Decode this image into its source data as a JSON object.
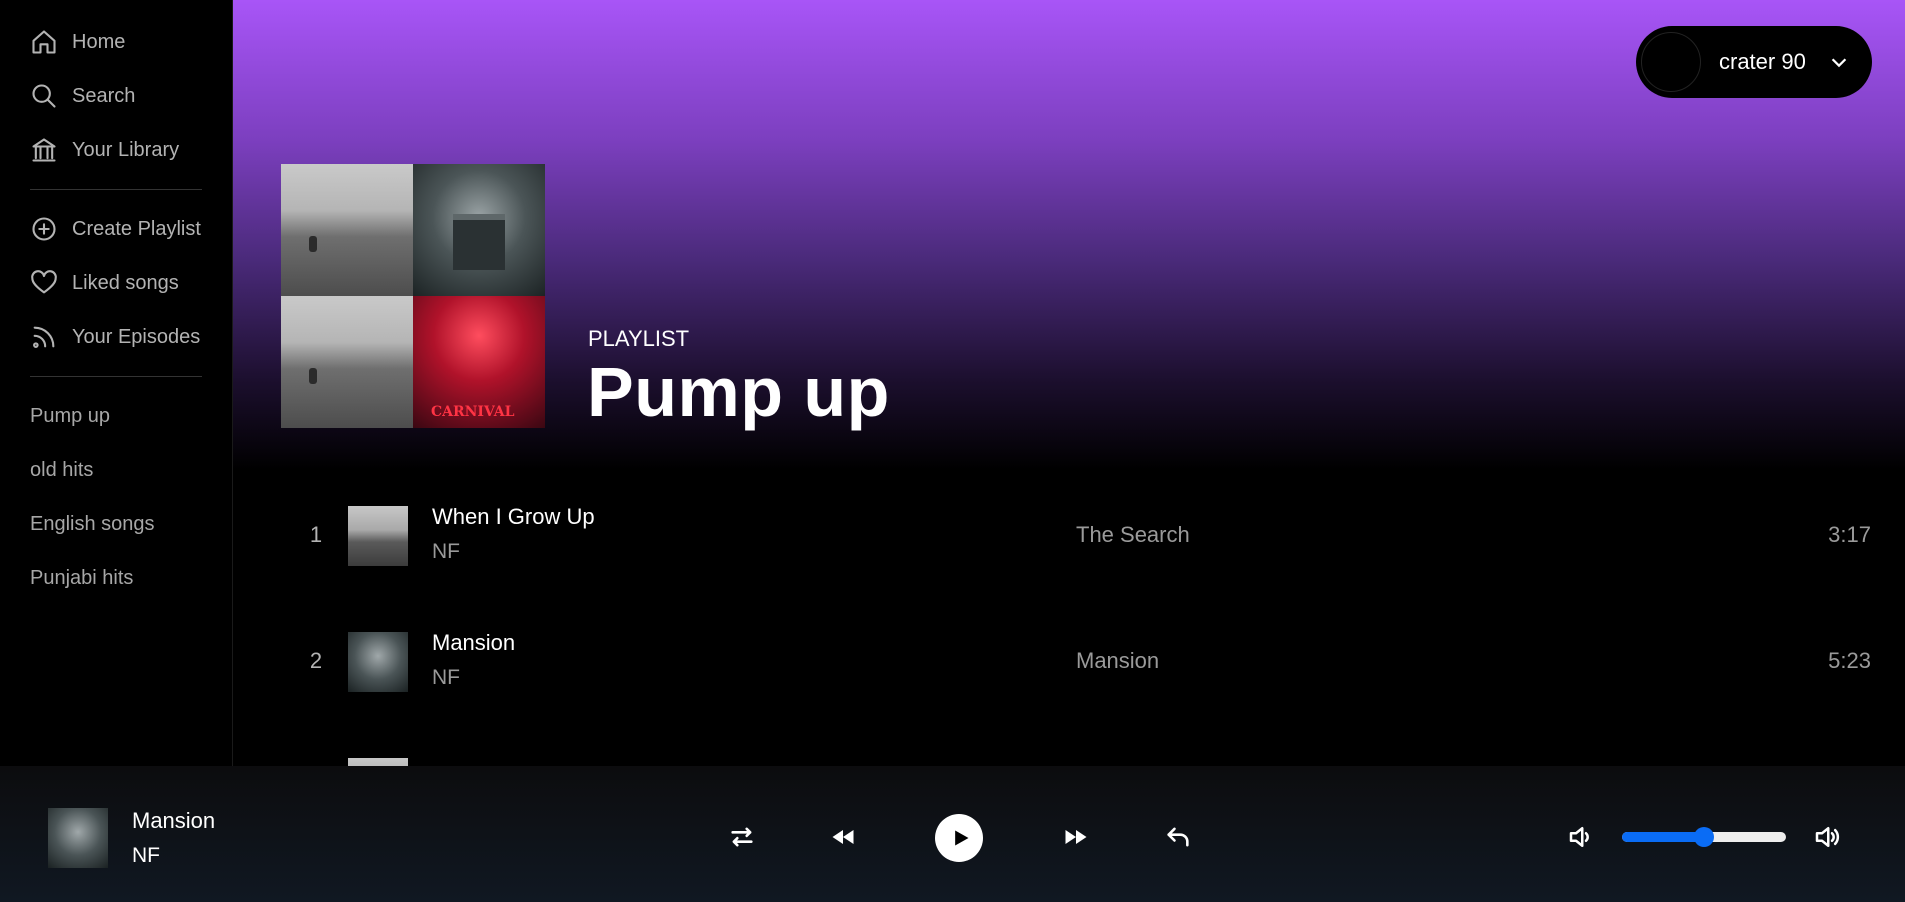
{
  "sidebar": {
    "nav": [
      {
        "label": "Home",
        "icon": "home-icon"
      },
      {
        "label": "Search",
        "icon": "search-icon"
      },
      {
        "label": "Your Library",
        "icon": "library-icon"
      }
    ],
    "actions": [
      {
        "label": "Create Playlist",
        "icon": "plus-circle-icon"
      },
      {
        "label": "Liked songs",
        "icon": "heart-icon"
      },
      {
        "label": "Your Episodes",
        "icon": "rss-icon"
      }
    ],
    "playlists": [
      "Pump up",
      "old hits",
      "English songs",
      "Punjabi hits"
    ]
  },
  "user": {
    "name": "crater 90"
  },
  "playlist": {
    "type": "PLAYLIST",
    "title": "Pump up"
  },
  "tracks": [
    {
      "num": "1",
      "title": "When I Grow Up",
      "artist": "NF",
      "album": "The Search",
      "duration": "3:17"
    },
    {
      "num": "2",
      "title": "Mansion",
      "artist": "NF",
      "album": "Mansion",
      "duration": "5:23"
    }
  ],
  "now_playing": {
    "title": "Mansion",
    "artist": "NF"
  },
  "volume": {
    "level": 0.5
  },
  "colors": {
    "accent": "#0a6cf5",
    "gradient_top": "#a855f7"
  }
}
